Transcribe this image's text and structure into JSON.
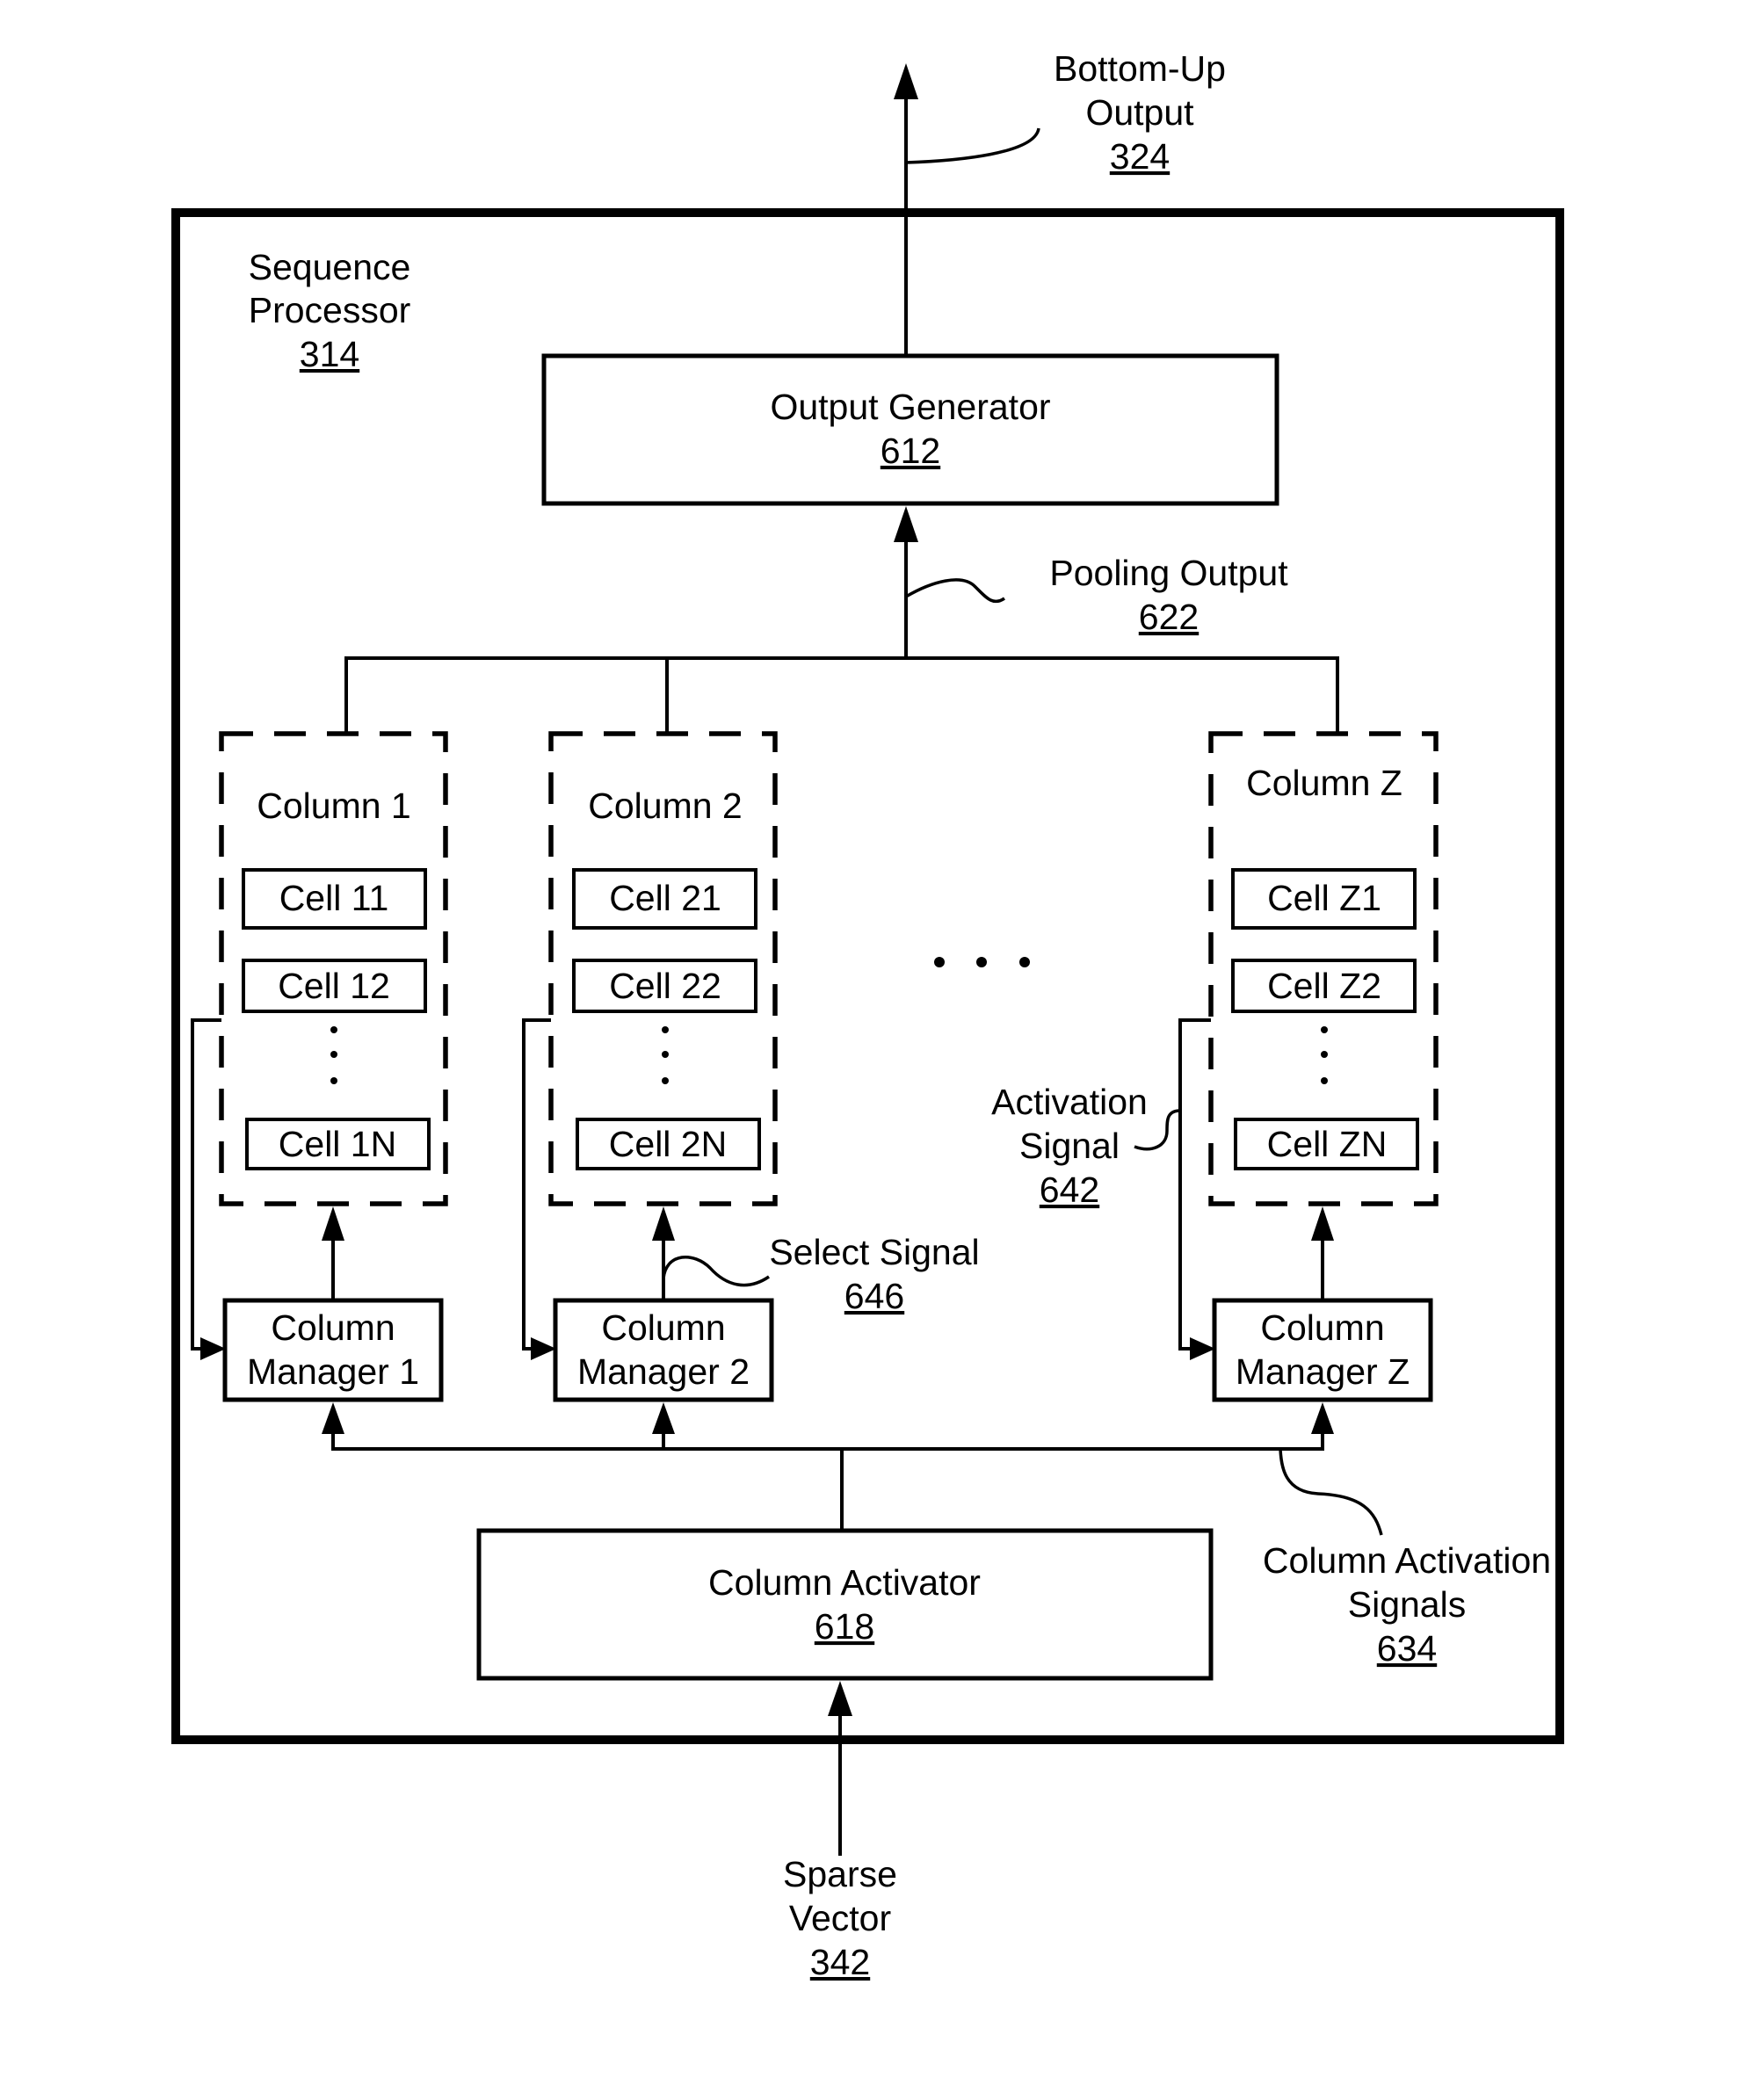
{
  "figure": {
    "container": {
      "title_line1": "Sequence",
      "title_line2": "Processor",
      "ref": "314"
    },
    "bottom_up_output": {
      "line1": "Bottom-Up",
      "line2": "Output",
      "ref": "324"
    },
    "output_generator": {
      "label": "Output Generator",
      "ref": "612"
    },
    "pooling_output": {
      "label": "Pooling Output",
      "ref": "622"
    },
    "columns": [
      {
        "title": "Column 1",
        "cells": [
          "Cell 11",
          "Cell 12",
          "Cell 1N"
        ],
        "manager_line1": "Column",
        "manager_line2": "Manager 1"
      },
      {
        "title": "Column 2",
        "cells": [
          "Cell 21",
          "Cell 22",
          "Cell 2N"
        ],
        "manager_line1": "Column",
        "manager_line2": "Manager 2"
      },
      {
        "title": "Column Z",
        "cells": [
          "Cell Z1",
          "Cell Z2",
          "Cell ZN"
        ],
        "manager_line1": "Column",
        "manager_line2": "Manager Z"
      }
    ],
    "select_signal": {
      "label": "Select Signal",
      "ref": "646"
    },
    "activation_signal": {
      "line1": "Activation",
      "line2": "Signal",
      "ref": "642"
    },
    "column_activation_signals": {
      "line1": "Column Activation",
      "line2": "Signals",
      "ref": "634"
    },
    "column_activator": {
      "label": "Column Activator",
      "ref": "618"
    },
    "sparse_vector": {
      "line1": "Sparse",
      "line2": "Vector",
      "ref": "342"
    },
    "ellipsis_icon": "horizontal-ellipsis",
    "colors": {
      "stroke": "#000000",
      "background": "#ffffff"
    }
  }
}
